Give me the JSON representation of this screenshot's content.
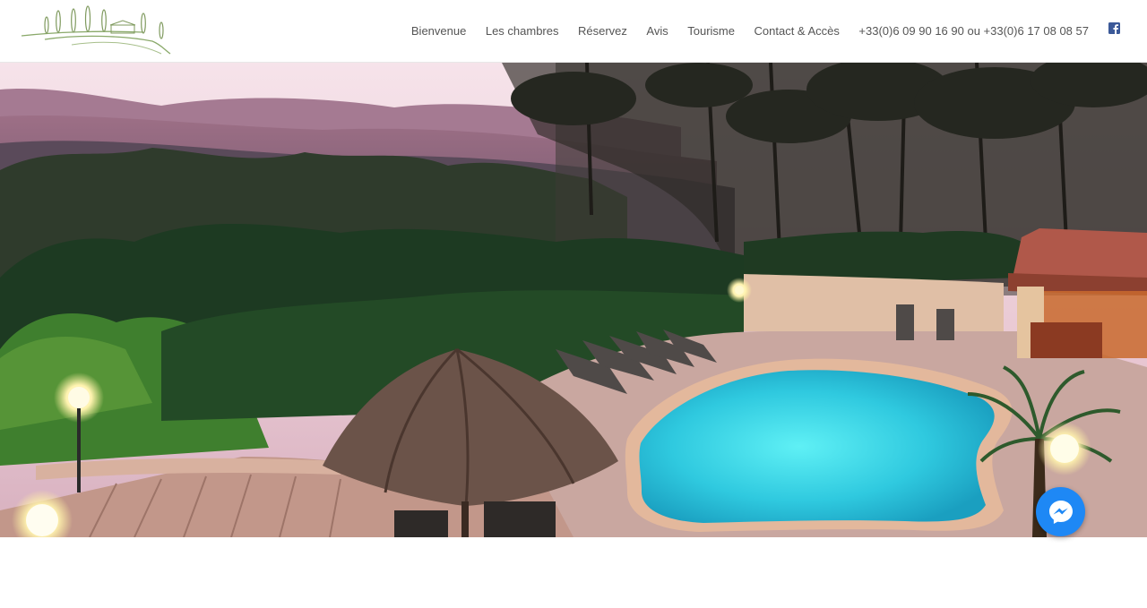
{
  "nav": {
    "items": [
      {
        "label": "Bienvenue"
      },
      {
        "label": "Les chambres"
      },
      {
        "label": "Réservez"
      },
      {
        "label": "Avis"
      },
      {
        "label": "Tourisme"
      },
      {
        "label": "Contact & Accès"
      },
      {
        "label": "+33(0)6 09 90 16 90 ou +33(0)6 17 08 08 57"
      }
    ],
    "facebook_icon": "facebook-icon"
  },
  "hero": {
    "description_icon": "pool-at-dusk-photo"
  },
  "chat": {
    "icon": "messenger-icon"
  },
  "colors": {
    "nav_text": "#555555",
    "facebook": "#3b5998",
    "messenger": "#1e88f5",
    "pool": "#40d6e6"
  }
}
